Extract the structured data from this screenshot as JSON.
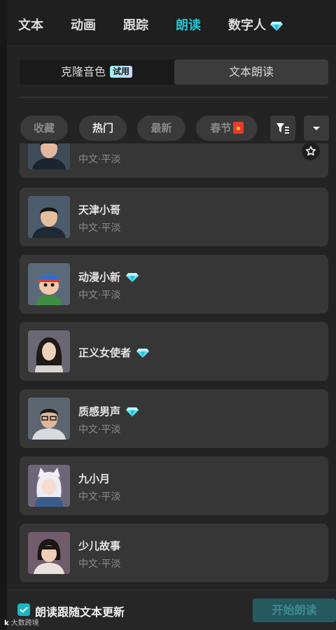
{
  "tabs": [
    {
      "label": "文本",
      "active": false
    },
    {
      "label": "动画",
      "active": false
    },
    {
      "label": "跟踪",
      "active": false
    },
    {
      "label": "朗读",
      "active": true
    },
    {
      "label": "数字人",
      "active": false,
      "icon": "diamond-icon"
    }
  ],
  "mode": {
    "clone_label": "克隆音色",
    "clone_badge": "试用",
    "tts_label": "文本朗读",
    "selected": "文本朗读"
  },
  "filters": {
    "chips": [
      {
        "label": "收藏",
        "active": false
      },
      {
        "label": "热门",
        "active": true
      },
      {
        "label": "最新",
        "active": false
      },
      {
        "label": "春节",
        "active": false,
        "icon": "red-packet-icon"
      }
    ],
    "filter_icon": "filter-icon",
    "dropdown_icon": "chevron-down-icon"
  },
  "voices": [
    {
      "name": "",
      "tag": "中文·平淡",
      "premium": false,
      "partial": true
    },
    {
      "name": "天津小哥",
      "tag": "中文·平淡",
      "premium": false
    },
    {
      "name": "动漫小新",
      "tag": "中文·平淡",
      "premium": true
    },
    {
      "name": "正义女使者",
      "tag": "",
      "premium": true
    },
    {
      "name": "质感男声",
      "tag": "中文·平淡",
      "premium": true
    },
    {
      "name": "九小月",
      "tag": "中文·平淡",
      "premium": false
    },
    {
      "name": "少儿故事",
      "tag": "中文·平淡",
      "premium": false
    }
  ],
  "footer": {
    "follow_checked": true,
    "follow_label": "朗读跟随文本更新",
    "start_label": "开始朗读"
  },
  "watermark": {
    "logo": "k",
    "text": "大数跨境"
  },
  "colors": {
    "accent": "#20c4cf",
    "panel": "#232323",
    "card": "#363636"
  }
}
